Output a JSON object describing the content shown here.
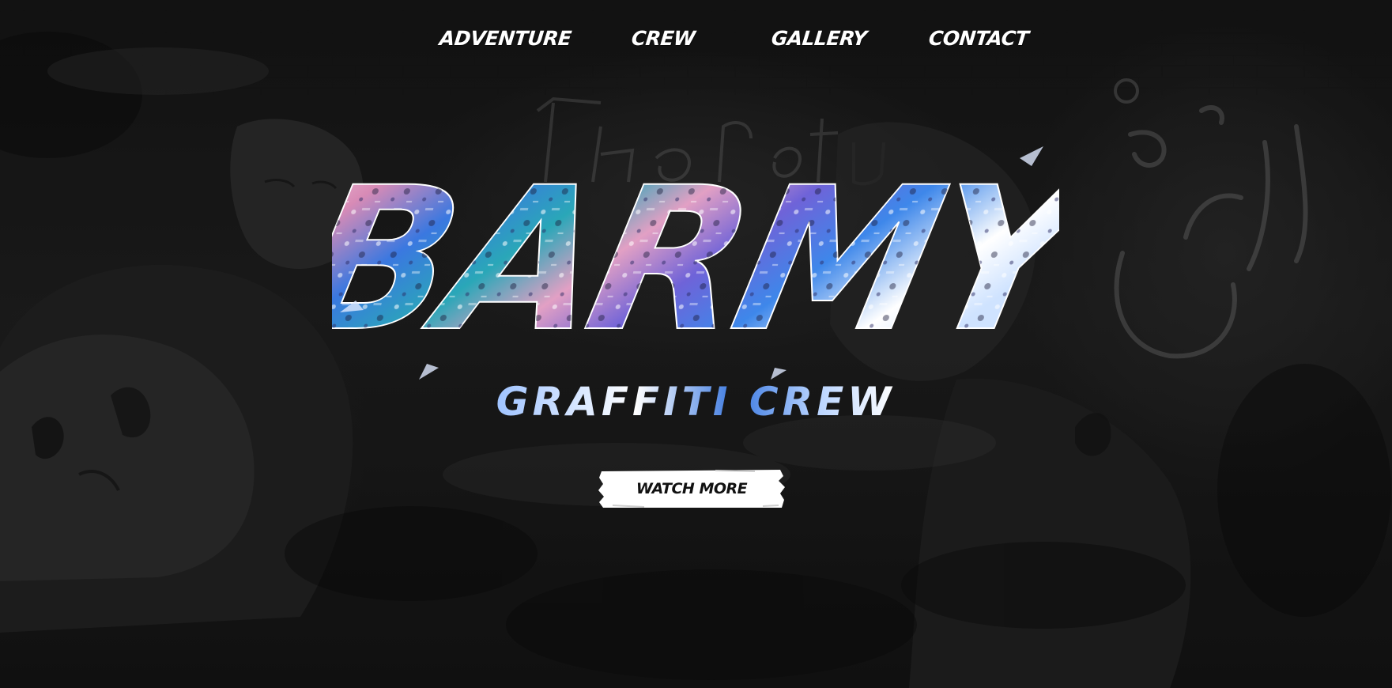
{
  "nav": {
    "items": [
      {
        "label": "ADVENTURE"
      },
      {
        "label": "CREW"
      },
      {
        "label": "GALLERY"
      },
      {
        "label": "CONTACT"
      }
    ]
  },
  "hero": {
    "logo_text": "BARMY",
    "tagline": "GRAFFITI CREW",
    "cta_label": "WATCH MORE"
  },
  "colors": {
    "background": "#1a1a1a",
    "text": "#ffffff",
    "accent_blue": "#3a78e0",
    "accent_pink": "#e7a3c7",
    "accent_teal": "#2aa7b8",
    "button_bg": "#ffffff",
    "button_text": "#111111"
  }
}
